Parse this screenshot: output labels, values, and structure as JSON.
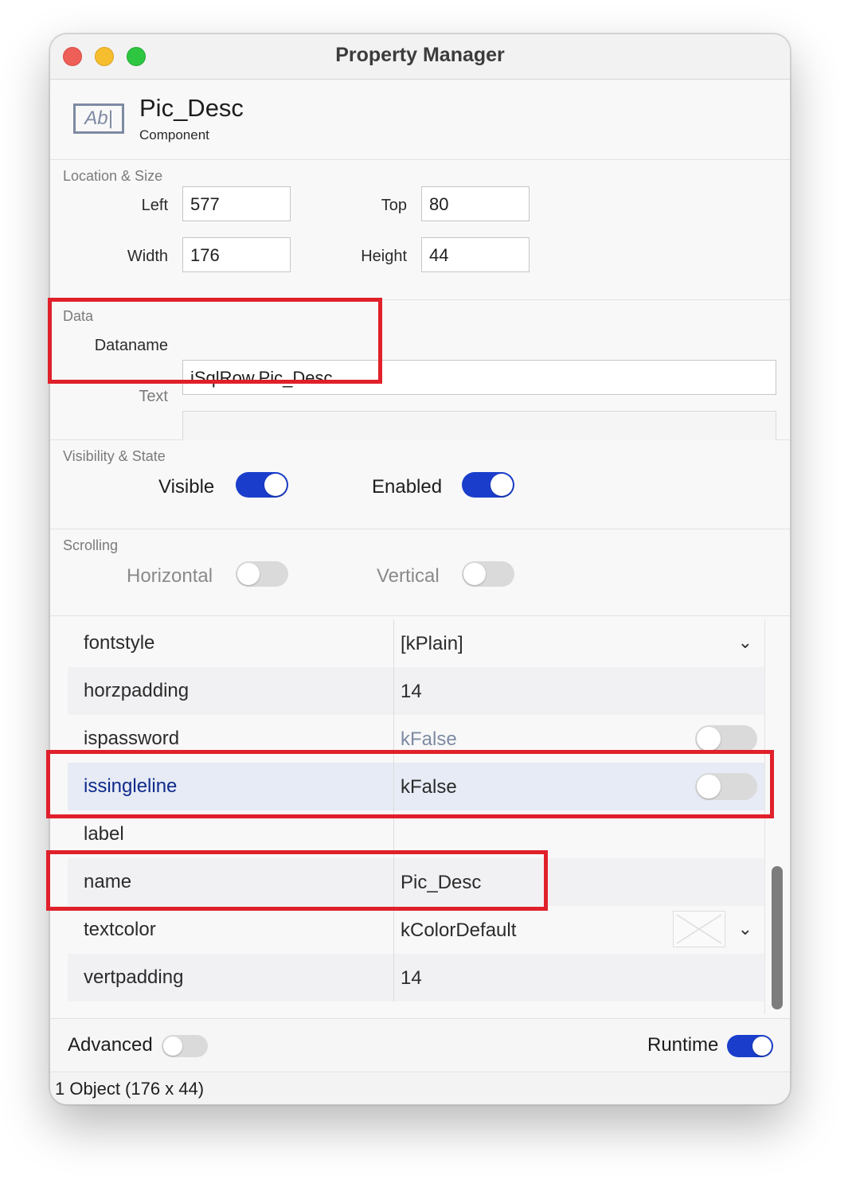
{
  "window": {
    "title": "Property Manager"
  },
  "component": {
    "icon": "text-field-icon",
    "icon_glyph": "Ab|",
    "name": "Pic_Desc",
    "type": "Component"
  },
  "location_size": {
    "label": "Location & Size",
    "left_label": "Left",
    "left_value": "577",
    "top_label": "Top",
    "top_value": "80",
    "width_label": "Width",
    "width_value": "176",
    "height_label": "Height",
    "height_value": "44"
  },
  "data_section": {
    "label": "Data",
    "dataname_label": "Dataname",
    "dataname_value": "iSqlRow.Pic_Desc",
    "text_label": "Text",
    "text_value": ""
  },
  "visibility": {
    "label": "Visibility & State",
    "visible_label": "Visible",
    "visible_on": true,
    "enabled_label": "Enabled",
    "enabled_on": true
  },
  "scrolling": {
    "label": "Scrolling",
    "horizontal_label": "Horizontal",
    "horizontal_on": false,
    "vertical_label": "Vertical",
    "vertical_on": false
  },
  "properties": [
    {
      "name": "fontstyle",
      "value": "[kPlain]",
      "control": "dropdown"
    },
    {
      "name": "horzpadding",
      "value": "14",
      "control": "none"
    },
    {
      "name": "ispassword",
      "value": "kFalse",
      "control": "toggle"
    },
    {
      "name": "issingleline",
      "value": "kFalse",
      "control": "toggle",
      "selected": true
    },
    {
      "name": "label",
      "value": "",
      "control": "none"
    },
    {
      "name": "name",
      "value": "Pic_Desc",
      "control": "none"
    },
    {
      "name": "textcolor",
      "value": "kColorDefault",
      "control": "color"
    },
    {
      "name": "vertpadding",
      "value": "14",
      "control": "none"
    }
  ],
  "footer": {
    "advanced_label": "Advanced",
    "advanced_on": false,
    "runtime_label": "Runtime",
    "runtime_on": true
  },
  "status": {
    "text": "1 Object (176 x 44)"
  },
  "colors": {
    "accent": "#1a3ecb",
    "highlight": "#e0202a",
    "selected_row": "#e6ebf5"
  }
}
